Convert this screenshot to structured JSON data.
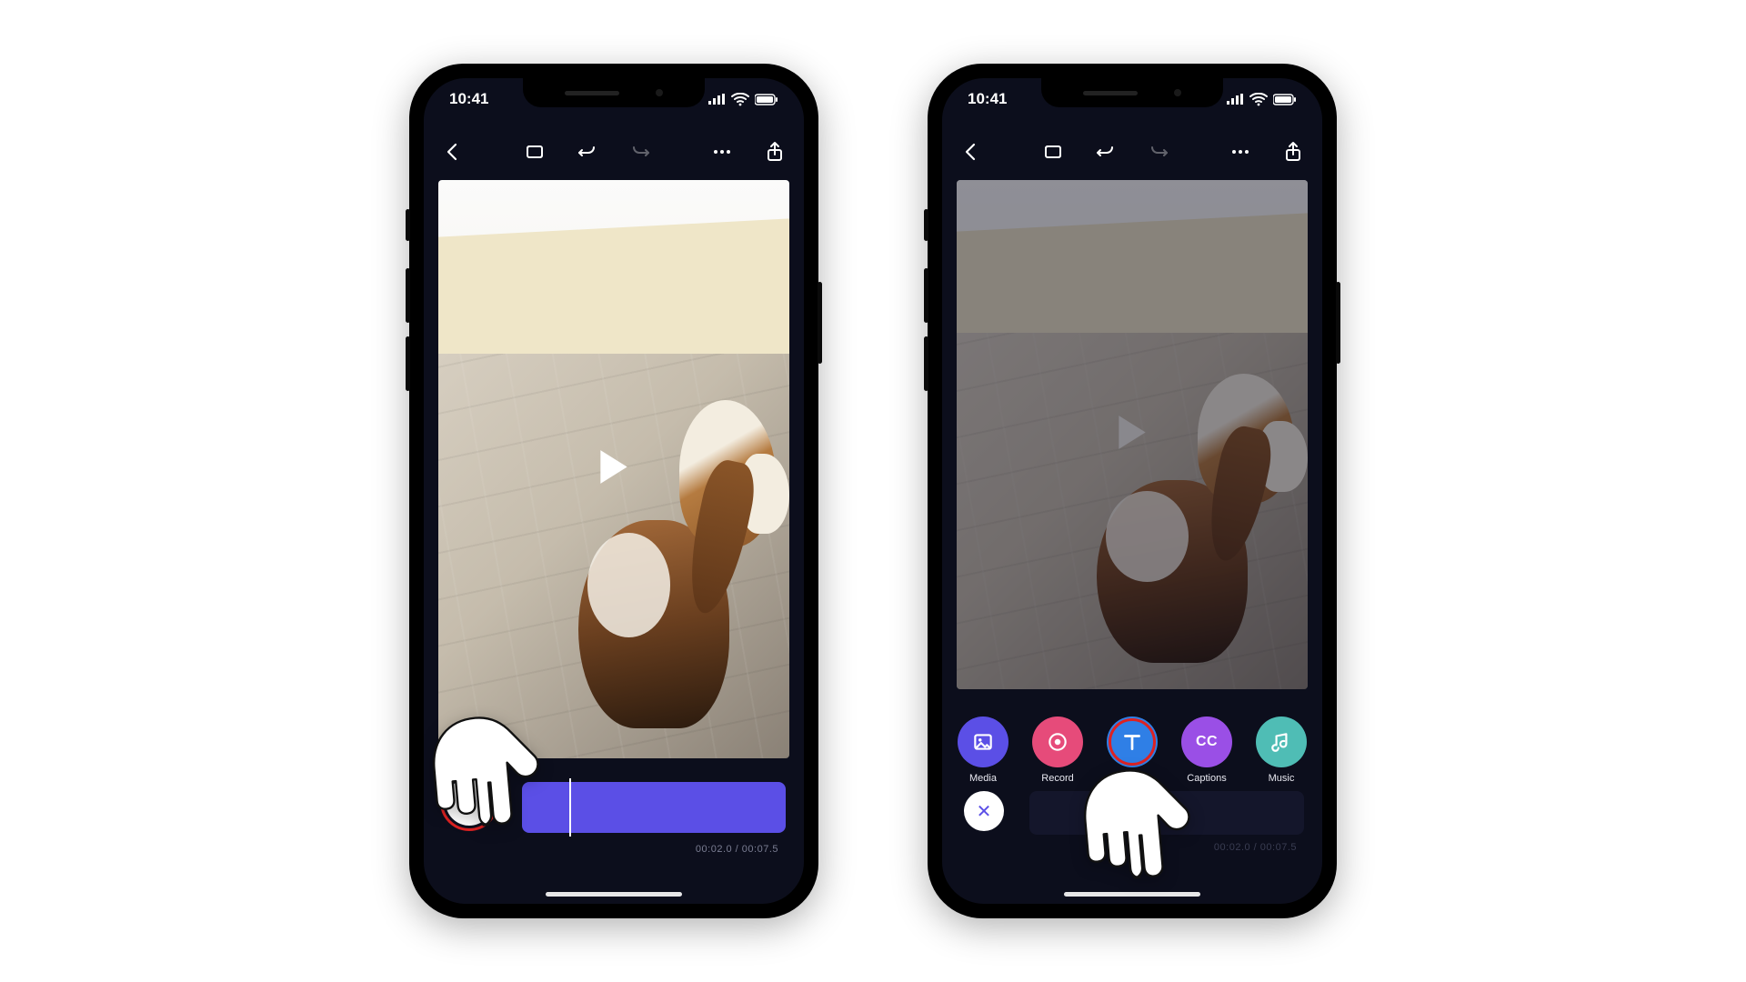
{
  "status": {
    "time": "10:41"
  },
  "timecode": {
    "current": "00:02.0",
    "total": "00:07.5"
  },
  "menu": {
    "media": "Media",
    "record": "Record",
    "text": "Text",
    "captions": "Captions",
    "music": "Music",
    "cc": "CC"
  },
  "add_glyph": "+",
  "close_glyph": "✕",
  "divider": " / "
}
